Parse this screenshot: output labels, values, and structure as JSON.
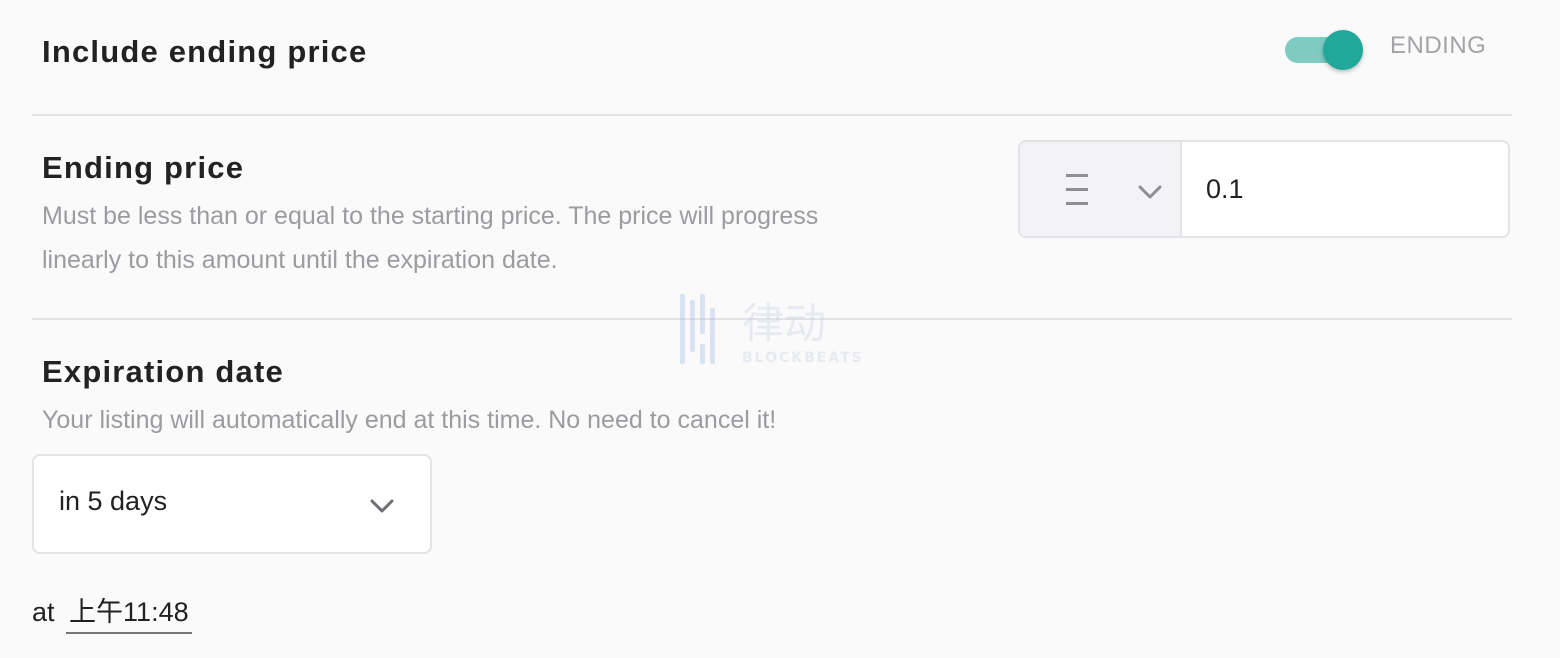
{
  "include_ending": {
    "title": "Include ending price",
    "toggle_on": true,
    "toggle_label": "ENDING",
    "accent_color": "#21a89a"
  },
  "ending_price": {
    "title": "Ending price",
    "helper_line1": "Must be less than or equal to the starting price. The price will progress",
    "helper_line2": "linearly to this amount until the expiration date.",
    "currency_icon": "eth-icon",
    "value": "0.1"
  },
  "expiration": {
    "title": "Expiration date",
    "helper": "Your listing will automatically end at this time. No need to cancel it!",
    "selected": "in 5 days",
    "time_prefix": "at",
    "time_value": "上午11:48"
  },
  "watermark": {
    "brand": "律动",
    "sub": "BLOCKBEATS"
  }
}
